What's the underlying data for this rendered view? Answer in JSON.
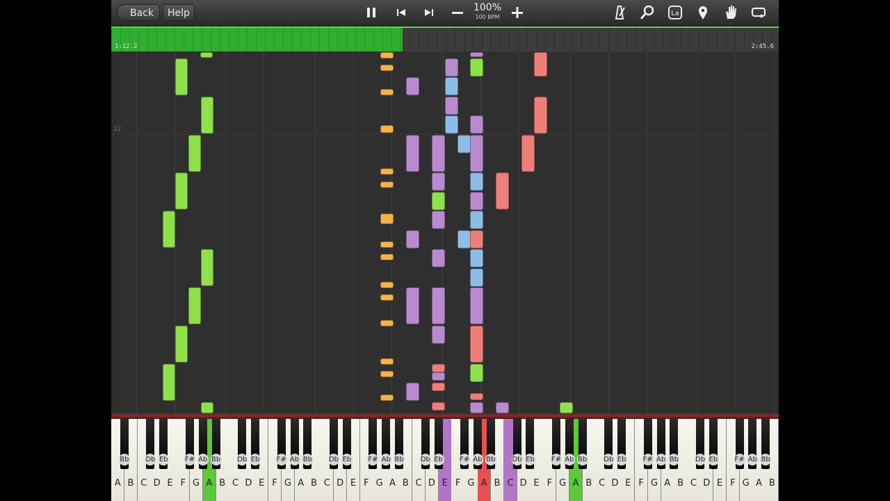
{
  "toolbar": {
    "back_label": "Back",
    "help_label": "Help",
    "tempo_percent": "100%",
    "tempo_bpm": "100 BPM",
    "icons": [
      "pause-icon",
      "skip-back-icon",
      "skip-forward-icon",
      "minus-icon",
      "plus-icon",
      "metronome-icon",
      "zoom-icon",
      "label-icon",
      "marker-icon",
      "hand-icon",
      "loop-icon"
    ],
    "label_icon_text": "La"
  },
  "progress": {
    "current_time": "1:12.2",
    "total_time": "2:45.6",
    "fraction": 0.436
  },
  "roll": {
    "measure_label": "32"
  },
  "colors": {
    "green": "#8fe04a",
    "orange": "#f5b24a",
    "purple": "#b98ad0",
    "blue": "#8dbde6",
    "red": "#f07e78",
    "green_key": "#5cc83a",
    "purple_key": "#b274c8",
    "red_key": "#e85050"
  },
  "keyboard": {
    "white_keys": [
      "A",
      "B",
      "C",
      "D",
      "E",
      "F",
      "G",
      "A",
      "B",
      "C",
      "D",
      "E",
      "F",
      "G",
      "A",
      "B",
      "C",
      "D",
      "E",
      "F",
      "G",
      "A",
      "B",
      "C",
      "D",
      "E",
      "F",
      "G",
      "A",
      "B",
      "C",
      "D",
      "E",
      "F",
      "G",
      "A",
      "B",
      "C",
      "D",
      "E",
      "F",
      "G",
      "A",
      "B",
      "C",
      "D",
      "E",
      "F",
      "G",
      "A",
      "B"
    ],
    "active_white": {
      "7": "green",
      "25": "purple",
      "28": "red",
      "30": "purple",
      "35": "green"
    },
    "black_labels": [
      "Bb",
      "",
      "Db",
      "Eb",
      "",
      "F#",
      "Ab",
      "Bb",
      "",
      "Db",
      "Eb",
      "",
      "F#",
      "Ab",
      "Bb",
      "",
      "Db",
      "Eb",
      "",
      "F#",
      "Ab",
      "Bb",
      "",
      "Db",
      "Eb",
      "",
      "F#",
      "Ab",
      "Bb",
      "",
      "Db",
      "Eb",
      "",
      "F#",
      "Ab",
      "Bb",
      "",
      "Db",
      "Eb",
      "",
      "F#",
      "Ab",
      "Bb",
      "",
      "Db",
      "Eb",
      "",
      "F#",
      "Ab",
      "Bb"
    ]
  }
}
